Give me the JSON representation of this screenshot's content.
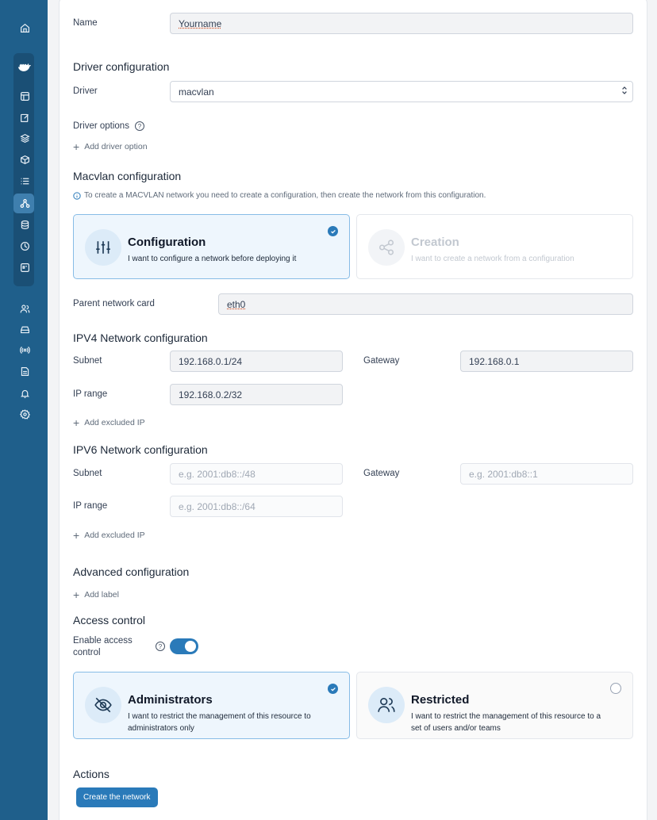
{
  "form": {
    "name_label": "Name",
    "name_value": "Yourname",
    "driver_section": "Driver configuration",
    "driver_label": "Driver",
    "driver_value": "macvlan",
    "driver_options_label": "Driver options",
    "add_driver_option": "Add driver option",
    "macvlan_section": "Macvlan configuration",
    "macvlan_info": "To create a MACVLAN network you need to create a configuration, then create the network from this configuration.",
    "config_card": {
      "title": "Configuration",
      "desc": "I want to configure a network before deploying it",
      "selected": true
    },
    "creation_card": {
      "title": "Creation",
      "desc": "I want to create a network from a configuration",
      "disabled": true
    },
    "parent_label": "Parent network card",
    "parent_value": "eth0",
    "ipv4_section": "IPV4 Network configuration",
    "ipv4": {
      "subnet_label": "Subnet",
      "subnet_value": "192.168.0.1/24",
      "gateway_label": "Gateway",
      "gateway_value": "192.168.0.1",
      "range_label": "IP range",
      "range_value": "192.168.0.2/32",
      "add_excluded": "Add excluded IP"
    },
    "ipv6_section": "IPV6 Network configuration",
    "ipv6": {
      "subnet_label": "Subnet",
      "subnet_placeholder": "e.g. 2001:db8::/48",
      "gateway_label": "Gateway",
      "gateway_placeholder": "e.g. 2001:db8::1",
      "range_label": "IP range",
      "range_placeholder": "e.g. 2001:db8::/64",
      "add_excluded": "Add excluded IP"
    },
    "advanced_section": "Advanced configuration",
    "add_label": "Add label",
    "access_section": "Access control",
    "enable_access_line1": "Enable access",
    "enable_access_line2": "control",
    "access_enabled": true,
    "admin_card": {
      "title": "Administrators",
      "desc_line1": "I want to restrict the management of this resource to",
      "desc_line2": "administrators only",
      "selected": true
    },
    "restricted_card": {
      "title": "Restricted",
      "desc_line1": "I want to restrict the management of this resource to a",
      "desc_line2": "set of users and/or teams",
      "selected": false
    },
    "actions_section": "Actions",
    "create_button": "Create the network"
  },
  "sidebar_icons": [
    "home-icon",
    "docker-icon",
    "dashboard-icon",
    "templates-icon",
    "stacks-icon",
    "containers-icon",
    "images-icon",
    "networks-icon",
    "volumes-icon",
    "events-icon",
    "host-icon",
    "users-icon",
    "environments-icon",
    "registries-icon",
    "logs-icon",
    "notifications-icon",
    "settings-icon"
  ],
  "colors": {
    "sidebar": "#1f5f8b",
    "accent": "#2a7ab9",
    "selected_card": "#eef6fd"
  }
}
